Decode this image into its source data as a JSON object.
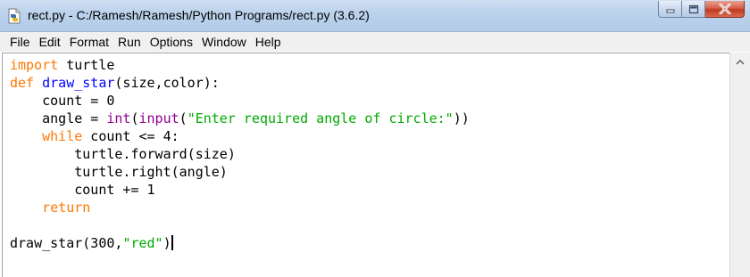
{
  "window": {
    "title": "rect.py - C:/Ramesh/Ramesh/Python Programs/rect.py (3.6.2)",
    "icons": {
      "app": "python-file-icon",
      "minimize": "minimize-icon",
      "maximize": "maximize-icon",
      "close": "close-icon",
      "scroll_up": "chevron-up-icon"
    }
  },
  "menu": {
    "items": [
      "File",
      "Edit",
      "Format",
      "Run",
      "Options",
      "Window",
      "Help"
    ]
  },
  "editor": {
    "lines": [
      [
        {
          "t": "kw",
          "s": "import"
        },
        {
          "t": "pl",
          "s": " turtle"
        }
      ],
      [
        {
          "t": "kw",
          "s": "def"
        },
        {
          "t": "pl",
          "s": " "
        },
        {
          "t": "fn",
          "s": "draw_star"
        },
        {
          "t": "pl",
          "s": "(size,color):"
        }
      ],
      [
        {
          "t": "pl",
          "s": "    count = 0"
        }
      ],
      [
        {
          "t": "pl",
          "s": "    angle = "
        },
        {
          "t": "bi",
          "s": "int"
        },
        {
          "t": "pl",
          "s": "("
        },
        {
          "t": "bi",
          "s": "input"
        },
        {
          "t": "pl",
          "s": "("
        },
        {
          "t": "str",
          "s": "\"Enter required angle of circle:\""
        },
        {
          "t": "pl",
          "s": "))"
        }
      ],
      [
        {
          "t": "pl",
          "s": "    "
        },
        {
          "t": "kw",
          "s": "while"
        },
        {
          "t": "pl",
          "s": " count <= 4:"
        }
      ],
      [
        {
          "t": "pl",
          "s": "        turtle.forward(size)"
        }
      ],
      [
        {
          "t": "pl",
          "s": "        turtle.right(angle)"
        }
      ],
      [
        {
          "t": "pl",
          "s": "        count += 1"
        }
      ],
      [
        {
          "t": "pl",
          "s": "    "
        },
        {
          "t": "kw",
          "s": "return"
        }
      ],
      [
        {
          "t": "pl",
          "s": ""
        }
      ],
      [
        {
          "t": "pl",
          "s": "draw_star(300,"
        },
        {
          "t": "str",
          "s": "\"red\""
        },
        {
          "t": "pl",
          "s": ")"
        }
      ]
    ],
    "cursor_line": 11
  },
  "colors": {
    "keyword": "#ff7700",
    "function_name": "#0000ff",
    "builtin": "#900090",
    "string": "#00aa00",
    "plain": "#000000"
  }
}
